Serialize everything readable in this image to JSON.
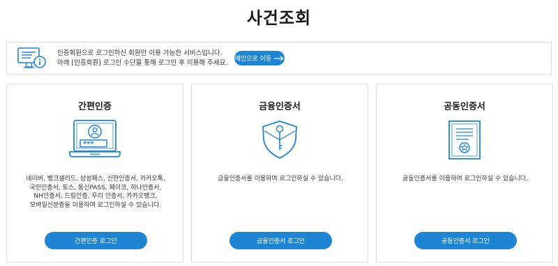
{
  "page": {
    "title": "사건조회"
  },
  "notice": {
    "line1": "인증회원으로 로그인하신 회원만 이용 가능한 서비스입니다.",
    "line2": "아래 [인증회원] 로그인 수단을 통해 로그인 후 이용해 주세요.",
    "button_label": "메인으로 이동",
    "icon": "computer-info-icon"
  },
  "cards": [
    {
      "title": "간편인증",
      "icon": "laptop-user-password-icon",
      "description": "네이버, 뱅크샐러드, 삼성패스, 신한인증서, 카카오톡,\n국민인증서, 토스, 통신PASS, 페이코, 하나인증서,\nNH인증서, 드림인증, 우리 인증서, 카카오뱅크,\n모바일신분증을 이용하여 로그인하실 수 있습니다.",
      "button_label": "간편인증 로그인",
      "password_mask": "***"
    },
    {
      "title": "금융인증서",
      "icon": "shield-key-icon",
      "description": "금융인증서를 이용하여 로그인하실 수 있습니다.",
      "button_label": "금융인증서 로그인"
    },
    {
      "title": "공동인증서",
      "icon": "certificate-icon",
      "description": "공동인증서를 이용하여 로그인하실 수 있습니다.",
      "button_label": "공동인증서 로그인"
    }
  ],
  "colors": {
    "accent": "#1e84d4",
    "border": "#dcdcdc"
  }
}
